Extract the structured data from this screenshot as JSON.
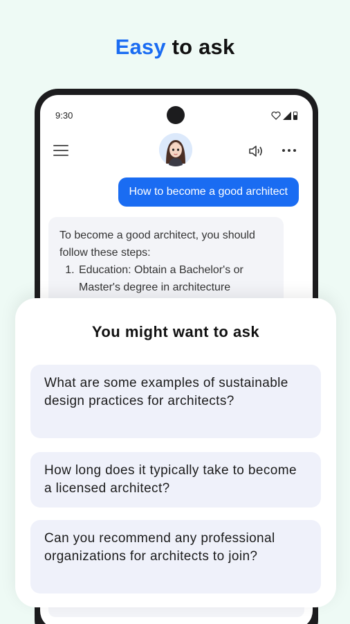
{
  "headline": {
    "accent": "Easy",
    "rest": " to ask"
  },
  "status_bar": {
    "time": "9:30"
  },
  "chat": {
    "user_message": "How to become a good architect",
    "bot_intro": "To become a good architect, you should follow these steps:",
    "bot_steps": [
      "Education: Obtain a Bachelor's or Master's degree in architecture"
    ]
  },
  "suggestions_sheet": {
    "title": "You might want to ask",
    "items": [
      "What are some examples of sustainable design practices for architects?",
      "How long does it typically take to become a licensed architect?",
      "Can you recommend any professional organizations for architects to join?"
    ]
  },
  "colors": {
    "accent": "#1a6cf2",
    "background": "#eefaf5",
    "suggestion_bg": "#eff1fa"
  },
  "icons": [
    "menu-icon",
    "avatar",
    "speaker-icon",
    "more-icon",
    "heart-icon",
    "signal-icon",
    "battery-icon"
  ]
}
